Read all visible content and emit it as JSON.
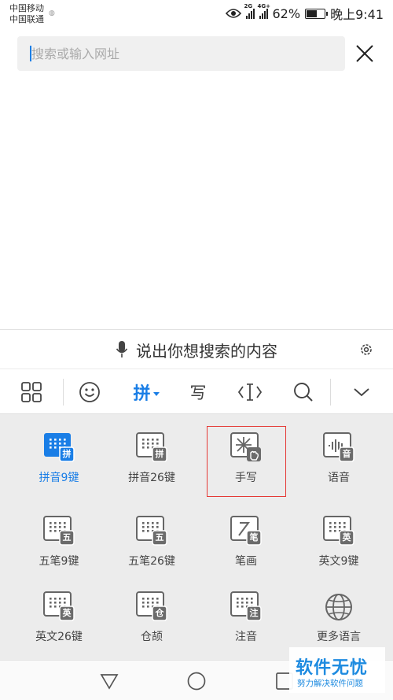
{
  "status_bar": {
    "carrier_1": "中国移动",
    "carrier_2": "中国联通",
    "carrier_icon": "hd-icon",
    "sim1_tag": "2G",
    "sim2_tag": "4G+",
    "battery_percent": "62%",
    "battery_level": 0.62,
    "time": "晚上9:41"
  },
  "search": {
    "placeholder": "搜索或输入网址",
    "value": ""
  },
  "voice_bar": {
    "prompt": "说出你想搜索的内容"
  },
  "toolbar": {
    "pinyin_tab": "拼",
    "handwrite_tab": "写",
    "icons": [
      "grid-icon",
      "emoji-icon",
      "pinyin-tab",
      "handwrite-tab",
      "cursor-icon",
      "search-icon",
      "collapse-chevron-icon"
    ]
  },
  "keyboards": [
    {
      "label": "拼音9键",
      "badge": "拼",
      "active": true
    },
    {
      "label": "拼音26键",
      "badge": "拼"
    },
    {
      "label": "手写",
      "badge": "",
      "highlighted": true
    },
    {
      "label": "语音",
      "badge": "音"
    },
    {
      "label": "五笔9键",
      "badge": "五"
    },
    {
      "label": "五笔26键",
      "badge": "五"
    },
    {
      "label": "笔画",
      "badge": "笔"
    },
    {
      "label": "英文9键",
      "badge": "英"
    },
    {
      "label": "英文26键",
      "badge": "英"
    },
    {
      "label": "仓颉",
      "badge": "仓"
    },
    {
      "label": "注音",
      "badge": "注"
    },
    {
      "label": "更多语言",
      "badge": ""
    }
  ],
  "watermark": {
    "main": "软件无忧",
    "sub": "努力解决软件问题"
  },
  "colors": {
    "accent": "#1a7ee6",
    "highlight_border": "#e53935",
    "panel_bg": "#ececec",
    "badge_bg": "#6b6b6b"
  }
}
